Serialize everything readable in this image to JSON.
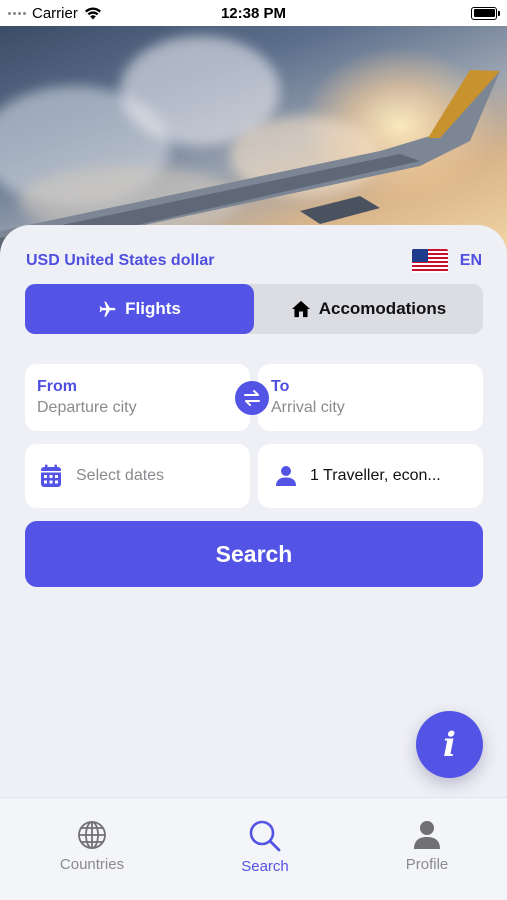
{
  "status_bar": {
    "carrier": "Carrier",
    "time": "12:38 PM"
  },
  "currency": {
    "label": "USD United States dollar"
  },
  "language": {
    "code": "EN",
    "flag": "us-flag-icon"
  },
  "mode_tabs": [
    {
      "label": "Flights",
      "icon": "airplane-icon",
      "active": true
    },
    {
      "label": "Accomodations",
      "icon": "house-icon",
      "active": false
    }
  ],
  "route": {
    "from_label": "From",
    "from_placeholder": "Departure city",
    "to_label": "To",
    "to_placeholder": "Arrival city"
  },
  "dates": {
    "placeholder": "Select dates"
  },
  "travellers": {
    "value": "1 Traveller, econ..."
  },
  "search_button": {
    "label": "Search"
  },
  "info_button": {
    "label": "i"
  },
  "tab_bar": [
    {
      "label": "Countries",
      "icon": "globe-icon",
      "active": false
    },
    {
      "label": "Search",
      "icon": "search-icon",
      "active": true
    },
    {
      "label": "Profile",
      "icon": "person-icon",
      "active": false
    }
  ],
  "colors": {
    "accent": "#5353e6",
    "text_accent": "#4f4fe0",
    "background": "#eff0f5"
  }
}
